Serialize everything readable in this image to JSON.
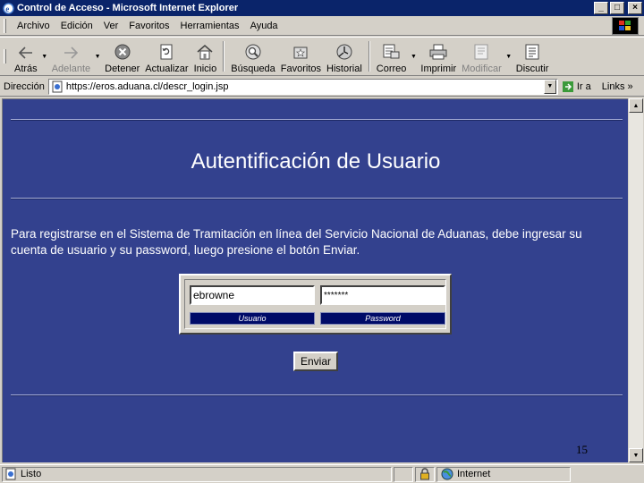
{
  "window": {
    "title": "Control de Acceso - Microsoft Internet Explorer",
    "buttons": {
      "minimize": "_",
      "maximize": "□",
      "close": "×"
    }
  },
  "menu": [
    "Archivo",
    "Edición",
    "Ver",
    "Favoritos",
    "Herramientas",
    "Ayuda"
  ],
  "toolbar": {
    "back": "Atrás",
    "forward": "Adelante",
    "stop": "Detener",
    "refresh": "Actualizar",
    "home": "Inicio",
    "search": "Búsqueda",
    "favorites": "Favoritos",
    "history": "Historial",
    "mail": "Correo",
    "print": "Imprimir",
    "edit": "Modificar",
    "discuss": "Discutir"
  },
  "address": {
    "label": "Dirección",
    "url": "https://eros.aduana.cl/descr_login.jsp",
    "go": "Ir a",
    "links": "Links »"
  },
  "page": {
    "title": "Autentificación de Usuario",
    "intro": "Para registrarse en el Sistema de Tramitación en línea del Servicio Nacional de Aduanas, debe ingresar su cuenta de usuario y su password, luego presione el botón Enviar.",
    "username_value": "ebrowne",
    "password_value": "*******",
    "username_label": "Usuario",
    "password_label": "Password",
    "submit": "Enviar",
    "slide_number": "15"
  },
  "status": {
    "text": "Listo",
    "zone": "Internet"
  },
  "colors": {
    "page_background": "#33418e",
    "title_bar": "#0a246a",
    "field_label_bg": "#000b68"
  }
}
